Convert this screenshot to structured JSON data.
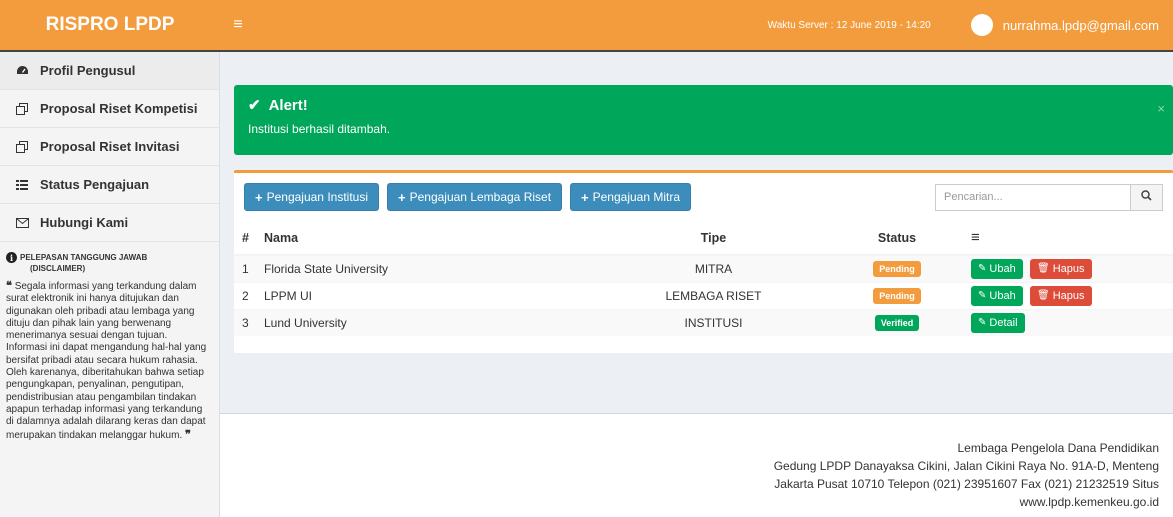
{
  "header": {
    "brand": "RISPRO LPDP",
    "menu_icon": "hamburger-icon",
    "server_time": "Waktu Server : 12 June 2019 - 14:20",
    "user_email": "nurrahma.lpdp@gmail.com",
    "color": "#f39c3d"
  },
  "sidebar": {
    "items": [
      {
        "label": "Profil Pengusul",
        "icon": "dashboard-icon"
      },
      {
        "label": "Proposal Riset Kompetisi",
        "icon": "copy-icon"
      },
      {
        "label": "Proposal Riset Invitasi",
        "icon": "copy-icon"
      },
      {
        "label": "Status Pengajuan",
        "icon": "grid-icon"
      },
      {
        "label": "Hubungi Kami",
        "icon": "envelope-icon"
      }
    ],
    "disclaimer_title_1": "PELEPASAN TANGGUNG JAWAB",
    "disclaimer_title_2": "(DISCLAIMER)",
    "disclaimer_text": "Segala informasi yang terkandung dalam surat elektronik ini hanya ditujukan dan digunakan oleh pribadi atau lembaga yang dituju dan pihak lain yang berwenang menerimanya sesuai dengan tujuan. Informasi ini dapat mengandung hal-hal yang bersifat pribadi atau secara hukum rahasia. Oleh karenanya, diberitahukan bahwa setiap pengungkapan, penyalinan, pengutipan, pendistribusian atau pengambilan tindakan apapun terhadap informasi yang terkandung di dalamnya adalah dilarang keras dan dapat merupakan tindakan melanggar hukum."
  },
  "alert": {
    "title": "Alert!",
    "message": "Institusi berhasil ditambah.",
    "close": "×",
    "color": "#00a65a"
  },
  "toolbar": {
    "btn_institusi": "Pengajuan Institusi",
    "btn_lembaga": "Pengajuan Lembaga Riset",
    "btn_mitra": "Pengajuan Mitra",
    "search_placeholder": "Pencarian..."
  },
  "table": {
    "headers": {
      "idx": "#",
      "nama": "Nama",
      "tipe": "Tipe",
      "status": "Status",
      "actions": "≡"
    },
    "rows": [
      {
        "idx": "1",
        "nama": "Florida State University",
        "tipe": "MITRA",
        "status": "Pending",
        "edit": "Ubah",
        "delete": "Hapus"
      },
      {
        "idx": "2",
        "nama": "LPPM UI",
        "tipe": "LEMBAGA RISET",
        "status": "Pending",
        "edit": "Ubah",
        "delete": "Hapus"
      },
      {
        "idx": "3",
        "nama": "Lund University",
        "tipe": "INSTITUSI",
        "status": "Verified",
        "detail": "Detail"
      }
    ]
  },
  "footer": {
    "line1": "Lembaga Pengelola Dana Pendidikan",
    "line2": "Gedung LPDP Danayaksa Cikini, Jalan Cikini Raya No. 91A-D, Menteng",
    "line3": "Jakarta Pusat 10710 Telepon (021) 23951607 Fax (021) 21232519 Situs",
    "line4": "www.lpdp.kemenkeu.go.id"
  }
}
